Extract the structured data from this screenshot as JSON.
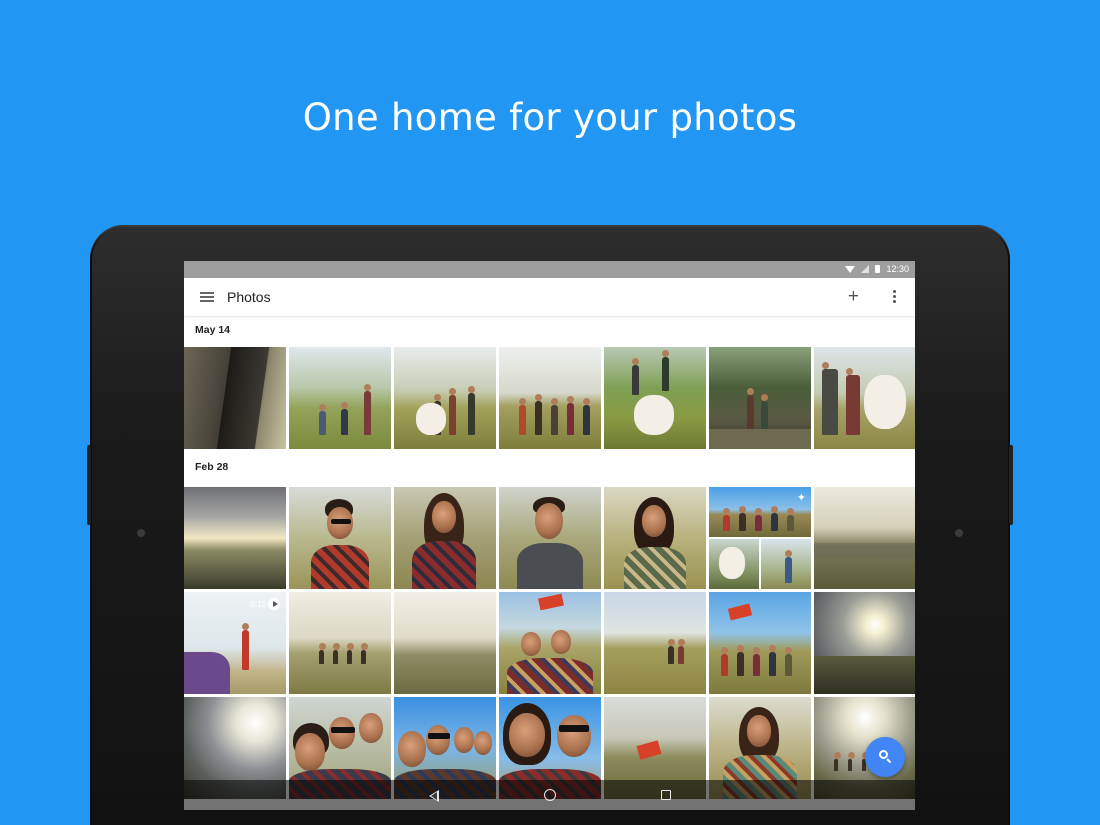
{
  "headline": "One home for your photos",
  "status_bar": {
    "time": "12:30"
  },
  "toolbar": {
    "title": "Photos"
  },
  "sections": [
    {
      "date": "May 14",
      "photos": [
        {
          "name": "photo-may-1",
          "kind": "tree-closeup"
        },
        {
          "name": "photo-may-2",
          "kind": "hikers-hill"
        },
        {
          "name": "photo-may-3",
          "kind": "hikers-with-dog"
        },
        {
          "name": "photo-may-4",
          "kind": "group-walking"
        },
        {
          "name": "photo-may-5",
          "kind": "dog-running"
        },
        {
          "name": "photo-may-6",
          "kind": "forest-hikers"
        },
        {
          "name": "photo-may-7",
          "kind": "couple-with-dog"
        }
      ]
    },
    {
      "date": "Feb 28",
      "photos": [
        {
          "name": "photo-feb-1",
          "kind": "sunset-landscape"
        },
        {
          "name": "photo-feb-2",
          "kind": "portrait-man-sunglasses"
        },
        {
          "name": "photo-feb-3",
          "kind": "portrait-woman-flannel"
        },
        {
          "name": "photo-feb-4",
          "kind": "portrait-man-hoodie"
        },
        {
          "name": "photo-feb-5",
          "kind": "portrait-woman-smiling"
        },
        {
          "name": "photo-feb-6",
          "kind": "auto-collage"
        },
        {
          "name": "photo-feb-7",
          "kind": "hill-landscape"
        },
        {
          "name": "photo-feb-8",
          "kind": "video-juggler",
          "duration": "0:12"
        },
        {
          "name": "photo-feb-9",
          "kind": "hill-group-far"
        },
        {
          "name": "photo-feb-10",
          "kind": "hill-empty"
        },
        {
          "name": "photo-feb-11",
          "kind": "group-flag"
        },
        {
          "name": "photo-feb-12",
          "kind": "hill-group-sitting"
        },
        {
          "name": "photo-feb-13",
          "kind": "group-flag-wide"
        },
        {
          "name": "photo-feb-14",
          "kind": "sun-clouds"
        },
        {
          "name": "photo-feb-15",
          "kind": "sunset-valley"
        },
        {
          "name": "photo-feb-16",
          "kind": "group-selfie"
        },
        {
          "name": "photo-feb-17",
          "kind": "group-selfie-sky"
        },
        {
          "name": "photo-feb-18",
          "kind": "couple-selfie"
        },
        {
          "name": "photo-feb-19",
          "kind": "flag-hill"
        },
        {
          "name": "photo-feb-20",
          "kind": "woman-wrapped"
        },
        {
          "name": "photo-feb-21",
          "kind": "hikers-horizon"
        }
      ]
    }
  ],
  "icons": {
    "menu": "menu-icon",
    "add": "plus-icon",
    "more": "more-vert-icon",
    "search": "search-icon",
    "auto_awesome": "sparkle-icon",
    "play": "play-icon"
  },
  "colors": {
    "background": "#2196F3",
    "fab": "#4285F4",
    "status_bar": "#9e9e9e"
  }
}
